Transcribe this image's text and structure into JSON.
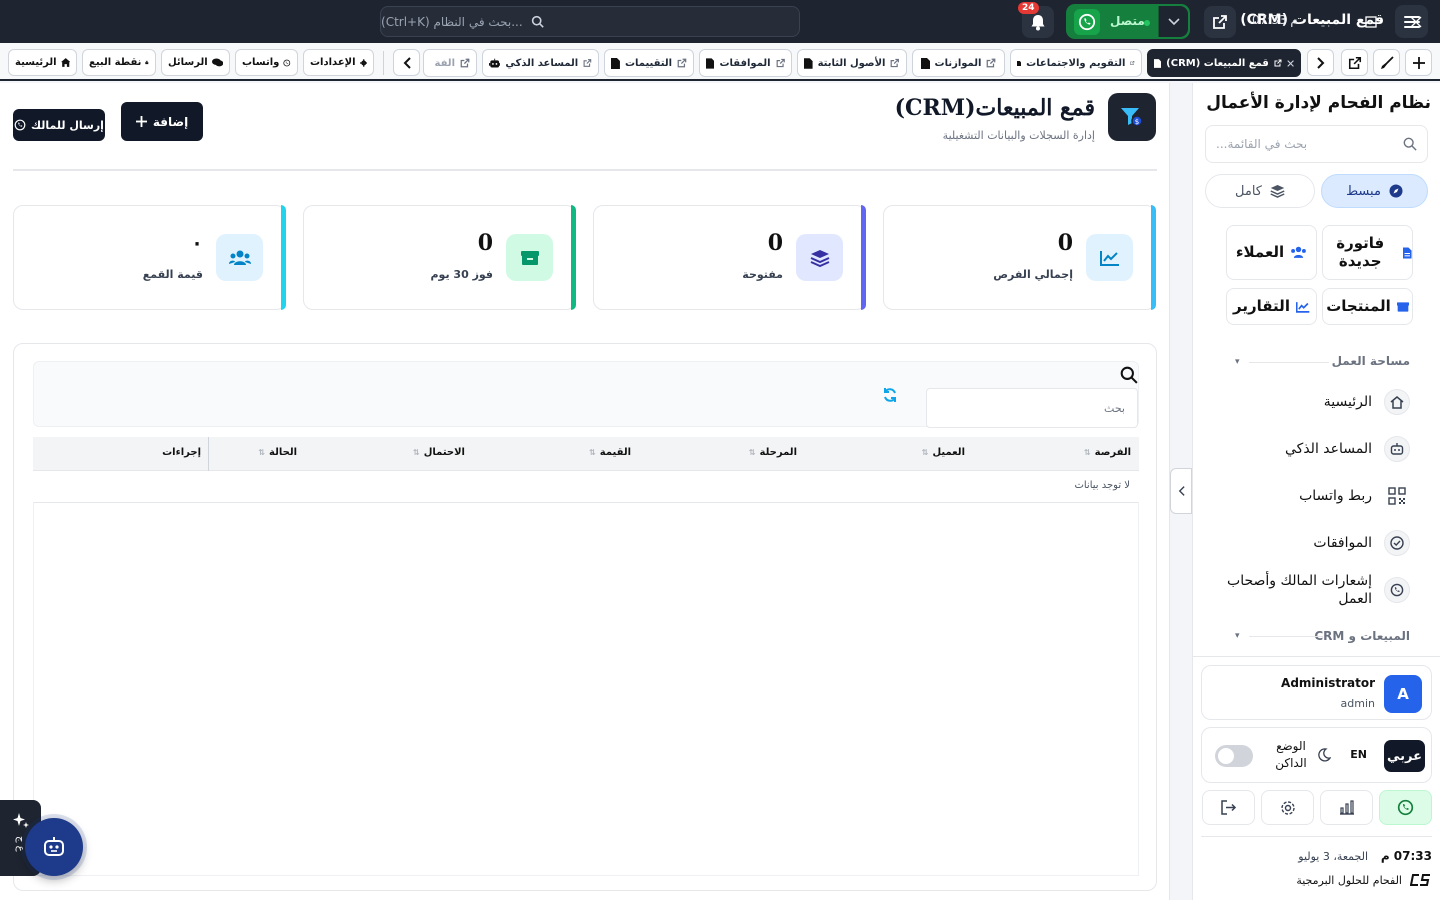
{
  "titlebar": {
    "title": "قمع المبيعات (CRM)",
    "search_placeholder": "...بحث في النظام (Ctrl+K)",
    "notifications_count": "24",
    "whatsapp_status": "متصل",
    "time": "07:33 م"
  },
  "quick_buttons": [
    {
      "label": "الرئيسية",
      "icon": "home-icon"
    },
    {
      "label": "نقطة البيع",
      "icon": "cash-register-icon"
    },
    {
      "label": "الرسائل",
      "icon": "comments-icon"
    },
    {
      "label": "واتساب",
      "icon": "whatsapp-icon"
    },
    {
      "label": "الإعدادات",
      "icon": "gear-icon"
    }
  ],
  "tabs": [
    {
      "label": "قمع المبيعات (CRM)",
      "active": true
    },
    {
      "label": "التقويم والاجتماعات"
    },
    {
      "label": "الموازنات"
    },
    {
      "label": "الأصول الثابتة"
    },
    {
      "label": "الموافقات"
    },
    {
      "label": "التقييمات"
    },
    {
      "label": "المساعد الذكي"
    },
    {
      "label": "الفة"
    }
  ],
  "page": {
    "title": "قمع المبيعات(CRM)",
    "subtitle": "إدارة السجلات والبيانات التشغيلية",
    "add_label": "إضافة",
    "send_label": "إرسال للمالك"
  },
  "stats": [
    {
      "value": "0",
      "label": "إجمالي الفرص",
      "color": "#38bdf8",
      "icon": "chart-line-icon"
    },
    {
      "value": "0",
      "label": "مفتوحة",
      "color": "#6366f1",
      "icon": "layers-icon"
    },
    {
      "value": "0",
      "label": "فوز 30 يوم",
      "color": "#10b981",
      "icon": "box-icon"
    },
    {
      "value": "٠",
      "label": "قيمة القمع",
      "color": "#22d3ee",
      "icon": "users-icon"
    }
  ],
  "table": {
    "search_placeholder": "بحث",
    "columns": [
      "الفرصة",
      "العميل",
      "المرحلة",
      "القيمة",
      "الاحتمال",
      "الحالة",
      "إجراءات"
    ],
    "empty_text": "لا توجد بيانات"
  },
  "ai_assistant_label": "ع ج",
  "sidebar": {
    "title": "نظام الفحام لإدارة الأعمال",
    "search_placeholder": "بحث في القائمة...",
    "mode_simple": "مبسط",
    "mode_full": "كامل",
    "quick_actions": [
      {
        "label": "فاتورة جديدة",
        "icon": "file-invoice-icon"
      },
      {
        "label": "العملاء",
        "icon": "users-icon"
      },
      {
        "label": "المنتجات",
        "icon": "box-icon"
      },
      {
        "label": "التقارير",
        "icon": "chart-line-icon"
      }
    ],
    "section_workspace": "مساحة العمل",
    "nav_items": [
      {
        "label": "الرئيسية",
        "icon": "home-icon"
      },
      {
        "label": "المساعد الذكي",
        "icon": "robot-icon"
      },
      {
        "label": "ربط واتساب",
        "icon": "qr-code-icon"
      },
      {
        "label": "الموافقات",
        "icon": "badge-check-icon"
      },
      {
        "label": "إشعارات المالك وأصحاب العمل",
        "icon": "whatsapp-icon"
      }
    ],
    "section_sales": "المبيعات و CRM",
    "user_name": "Administrator",
    "user_role": "admin",
    "avatar_letter": "A",
    "lang_ar": "عربي",
    "lang_en": "EN",
    "dark_mode": "الوضع الداكن",
    "clock": "07:33 م",
    "date": "الجمعة، 3 يوليو",
    "brand": "الفحام للحلول البرمجية"
  }
}
